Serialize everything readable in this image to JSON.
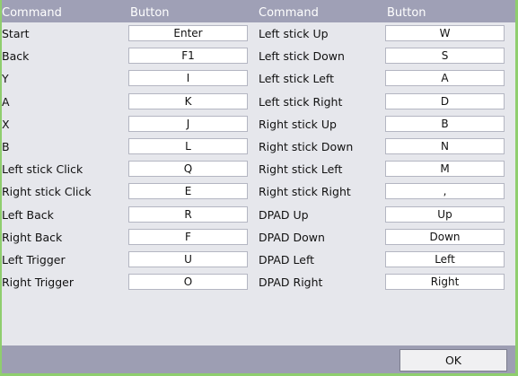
{
  "headers": {
    "command": "Command",
    "button": "Button"
  },
  "left_column": [
    {
      "command": "Start",
      "button": "Enter"
    },
    {
      "command": "Back",
      "button": "F1"
    },
    {
      "command": "Y",
      "button": "I"
    },
    {
      "command": "A",
      "button": "K"
    },
    {
      "command": "X",
      "button": "J"
    },
    {
      "command": "B",
      "button": "L"
    },
    {
      "command": "Left stick Click",
      "button": "Q"
    },
    {
      "command": "Right stick Click",
      "button": "E"
    },
    {
      "command": "Left Back",
      "button": "R"
    },
    {
      "command": "Right Back",
      "button": "F"
    },
    {
      "command": "Left Trigger",
      "button": "U"
    },
    {
      "command": "Right Trigger",
      "button": "O"
    }
  ],
  "right_column": [
    {
      "command": "Left stick Up",
      "button": "W"
    },
    {
      "command": "Left stick Down",
      "button": "S"
    },
    {
      "command": "Left stick Left",
      "button": "A"
    },
    {
      "command": "Left stick Right",
      "button": "D"
    },
    {
      "command": "Right stick Up",
      "button": "B"
    },
    {
      "command": "Right stick Down",
      "button": "N"
    },
    {
      "command": "Right stick Left",
      "button": "M"
    },
    {
      "command": "Right stick Right",
      "button": ","
    },
    {
      "command": "DPAD Up",
      "button": "Up"
    },
    {
      "command": "DPAD Down",
      "button": "Down"
    },
    {
      "command": "DPAD Left",
      "button": "Left"
    },
    {
      "command": "DPAD Right",
      "button": "Right"
    }
  ],
  "ok_label": "OK",
  "colors": {
    "header": "#9fa0b6",
    "content": "#e6e7ec",
    "footer": "#9d9eb3",
    "frame": "#8fce6e"
  }
}
